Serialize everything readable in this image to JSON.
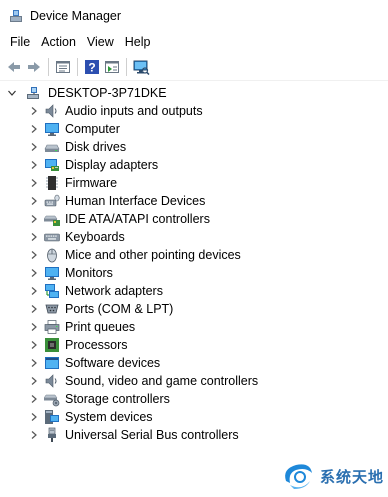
{
  "window": {
    "title": "Device Manager"
  },
  "menu": [
    {
      "label": "File"
    },
    {
      "label": "Action"
    },
    {
      "label": "View"
    },
    {
      "label": "Help"
    }
  ],
  "toolbar": [
    {
      "icon": "back-arrow-icon"
    },
    {
      "icon": "forward-arrow-icon"
    },
    {
      "icon": "properties-icon"
    },
    {
      "icon": "help-icon"
    },
    {
      "icon": "show-hidden-icon"
    },
    {
      "icon": "scan-hardware-icon"
    }
  ],
  "tree": {
    "root": {
      "label": "DESKTOP-3P71DKE",
      "expanded": true,
      "icon": "computer-tree-icon"
    },
    "items": [
      {
        "label": "Audio inputs and outputs",
        "icon": "speaker-icon"
      },
      {
        "label": "Computer",
        "icon": "monitor-icon"
      },
      {
        "label": "Disk drives",
        "icon": "disk-drive-icon"
      },
      {
        "label": "Display adapters",
        "icon": "display-adapter-icon"
      },
      {
        "label": "Firmware",
        "icon": "chip-icon"
      },
      {
        "label": "Human Interface Devices",
        "icon": "hid-icon"
      },
      {
        "label": "IDE ATA/ATAPI controllers",
        "icon": "ide-controller-icon"
      },
      {
        "label": "Keyboards",
        "icon": "keyboard-icon"
      },
      {
        "label": "Mice and other pointing devices",
        "icon": "mouse-icon"
      },
      {
        "label": "Monitors",
        "icon": "monitor-icon"
      },
      {
        "label": "Network adapters",
        "icon": "network-adapter-icon"
      },
      {
        "label": "Ports (COM & LPT)",
        "icon": "port-icon"
      },
      {
        "label": "Print queues",
        "icon": "printer-icon"
      },
      {
        "label": "Processors",
        "icon": "processor-icon"
      },
      {
        "label": "Software devices",
        "icon": "software-device-icon"
      },
      {
        "label": "Sound, video and game controllers",
        "icon": "speaker-icon"
      },
      {
        "label": "Storage controllers",
        "icon": "storage-controller-icon"
      },
      {
        "label": "System devices",
        "icon": "system-device-icon"
      },
      {
        "label": "Universal Serial Bus controllers",
        "icon": "usb-icon"
      }
    ]
  },
  "watermark": {
    "text": "系统天地"
  },
  "colors": {
    "accent": "#1e88d9",
    "watermark": "#2a6fb0"
  }
}
